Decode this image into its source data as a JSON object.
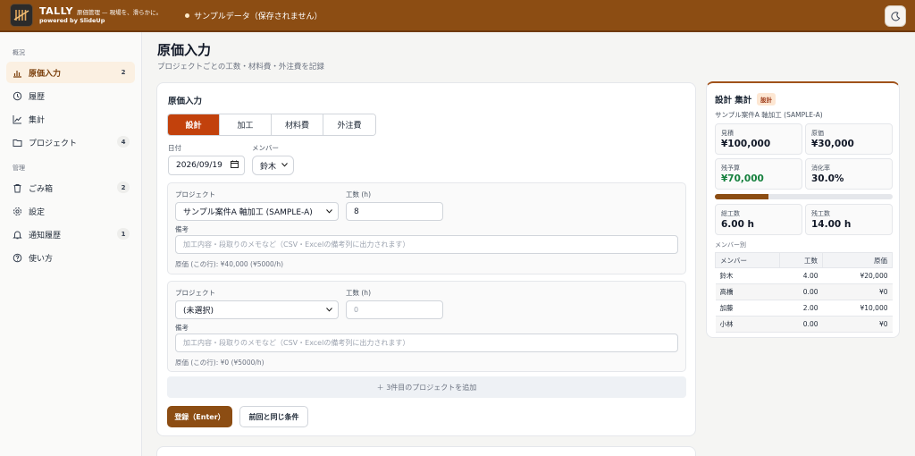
{
  "header": {
    "app_name": "TALLY",
    "tagline": "原価管理 — 現場を、滑らかに。",
    "powered_by": "powered by SlideUp",
    "sample_notice": "サンプルデータ（保存されません）"
  },
  "sidebar": {
    "section_overview": "概況",
    "section_manage": "管理",
    "items": [
      {
        "label": "原価入力",
        "badge": "2",
        "icon": "bar-chart-icon"
      },
      {
        "label": "履歴",
        "badge": "",
        "icon": "history-icon"
      },
      {
        "label": "集計",
        "badge": "",
        "icon": "line-chart-icon"
      },
      {
        "label": "プロジェクト",
        "badge": "4",
        "icon": "folder-icon"
      },
      {
        "label": "ごみ箱",
        "badge": "2",
        "icon": "trash-icon"
      },
      {
        "label": "設定",
        "badge": "",
        "icon": "gear-icon"
      },
      {
        "label": "通知履歴",
        "badge": "1",
        "icon": "bell-icon"
      },
      {
        "label": "使い方",
        "badge": "",
        "icon": "help-icon"
      }
    ]
  },
  "page": {
    "title": "原価入力",
    "subtitle": "プロジェクトごとの工数・材料費・外注費を記録"
  },
  "form": {
    "title": "原価入力",
    "tabs": [
      "設計",
      "加工",
      "材料費",
      "外注費"
    ],
    "date_label": "日付",
    "date_value": "2026/09/19",
    "member_label": "メンバー",
    "member_value": "鈴木",
    "entries": [
      {
        "project_label": "プロジェクト",
        "project_value": "サンプル案件A 軸加工 (SAMPLE-A)",
        "hours_label": "工数 (h)",
        "hours_value": "8",
        "note_label": "備考",
        "note_placeholder": "加工内容・段取りのメモなど（CSV・Excelの備考列に出力されます）",
        "cost_line": "原価 (この行): ¥40,000 (¥5000/h)"
      },
      {
        "project_label": "プロジェクト",
        "project_value": "(未選択)",
        "hours_label": "工数 (h)",
        "hours_placeholder": "0",
        "note_label": "備考",
        "note_placeholder": "加工内容・段取りのメモなど（CSV・Excelの備考列に出力されます）",
        "cost_line": "原価 (この行): ¥0 (¥5000/h)"
      }
    ],
    "add_project": "＋ 3件目のプロジェクトを追加",
    "submit": "登録（Enter）",
    "same_as_last": "前回と同じ条件"
  },
  "summary": {
    "title": "設計 集計",
    "tag": "設計",
    "project": "サンプル案件A 軸加工 (SAMPLE-A)",
    "stats": [
      {
        "label": "見積",
        "value": "¥100,000"
      },
      {
        "label": "原価",
        "value": "¥30,000"
      },
      {
        "label": "残予算",
        "value": "¥70,000"
      },
      {
        "label": "消化率",
        "value": "30.0%"
      },
      {
        "label": "総工数",
        "value": "6.00 h"
      },
      {
        "label": "残工数",
        "value": "14.00 h"
      }
    ],
    "progress": 0.3,
    "member_section": "メンバー別",
    "table_headers": [
      "メンバー",
      "工数",
      "原価"
    ],
    "members": [
      {
        "name": "鈴木",
        "hours": "4.00",
        "cost": "¥20,000"
      },
      {
        "name": "高橋",
        "hours": "0.00",
        "cost": "¥0"
      },
      {
        "name": "加藤",
        "hours": "2.00",
        "cost": "¥10,000"
      },
      {
        "name": "小林",
        "hours": "0.00",
        "cost": "¥0"
      }
    ]
  },
  "colors": {
    "header": "#8c4d13",
    "accent": "#c2410c",
    "positive": "#15803d"
  }
}
